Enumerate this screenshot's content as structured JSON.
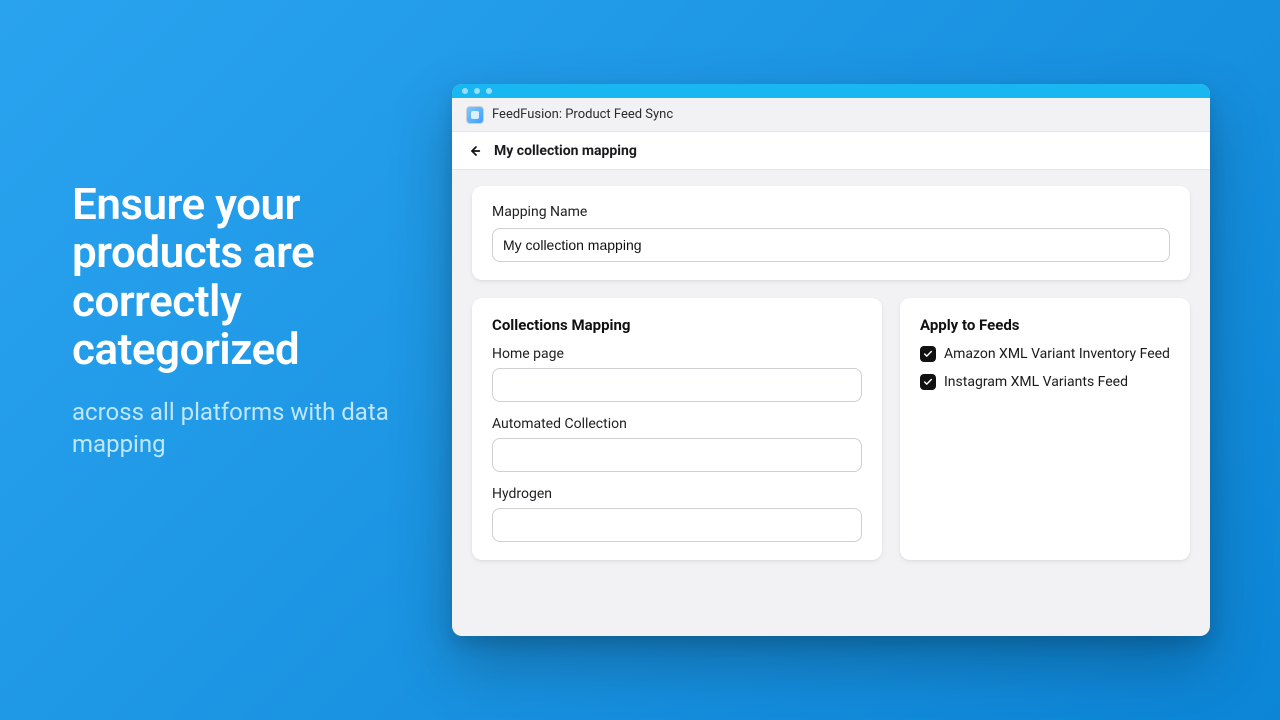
{
  "hero": {
    "headline": "Ensure your products are correctly categorized",
    "subline": "across all platforms with data mapping"
  },
  "app": {
    "name": "FeedFusion: Product Feed Sync"
  },
  "page": {
    "title": "My collection mapping"
  },
  "mapping": {
    "name_label": "Mapping Name",
    "name_value": "My collection mapping"
  },
  "collections": {
    "title": "Collections Mapping",
    "items": [
      {
        "label": "Home page",
        "value": ""
      },
      {
        "label": "Automated Collection",
        "value": ""
      },
      {
        "label": "Hydrogen",
        "value": ""
      }
    ]
  },
  "feeds": {
    "title": "Apply to Feeds",
    "items": [
      {
        "label": "Amazon XML Variant Inventory Feed",
        "checked": true
      },
      {
        "label": "Instagram XML Variants Feed",
        "checked": true
      }
    ]
  }
}
